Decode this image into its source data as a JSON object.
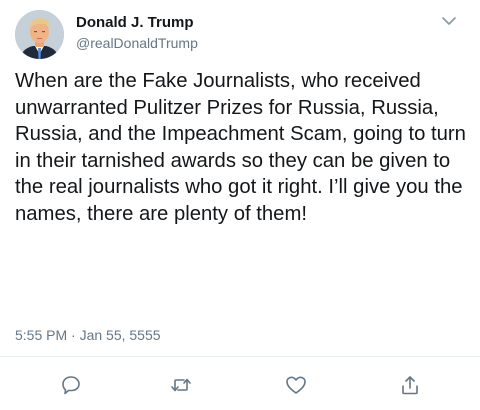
{
  "author": {
    "name": "Donald J. Trump",
    "handle": "@realDonaldTrump"
  },
  "tweet": {
    "text": "When are the Fake Journalists, who received unwarranted Pulitzer Prizes for Russia, Russia, Russia, and the Impeachment Scam, going to turn in their tarnished awards so they can be given to the real journalists who got it right. I’ll give you the names, there are plenty of them!",
    "timestamp": "5:55 PM · Jan 55, 5555"
  },
  "icons": {
    "menu": "chevron-down-icon",
    "reply": "reply-icon",
    "retweet": "retweet-icon",
    "like": "heart-icon",
    "share": "share-icon"
  },
  "colors": {
    "text": "#14171a",
    "secondary": "#657786",
    "divider": "#e6ecf0"
  }
}
